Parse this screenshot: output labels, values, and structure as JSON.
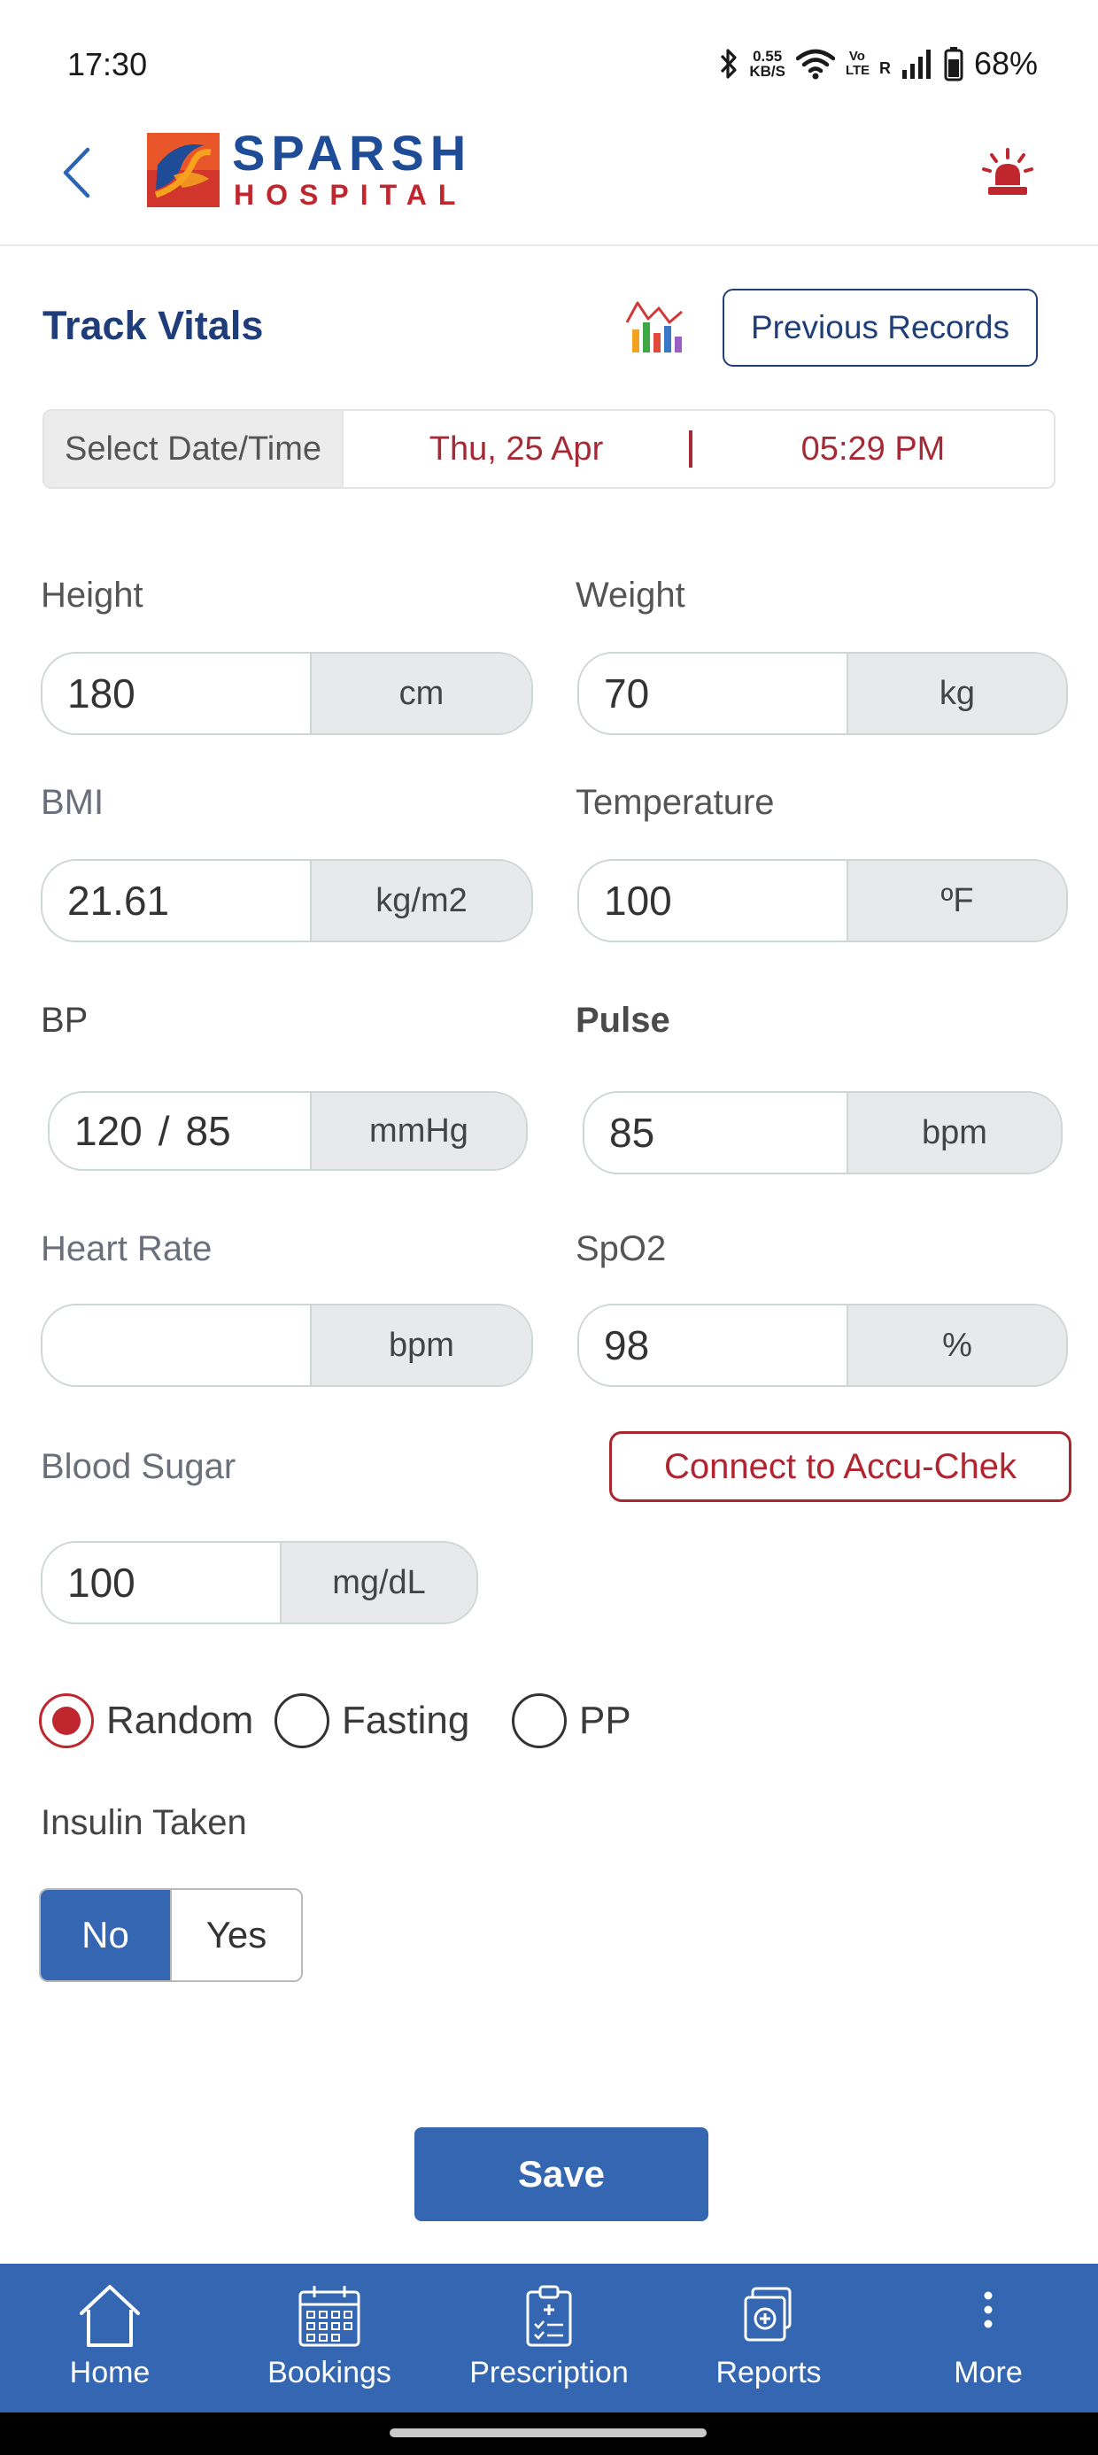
{
  "status_bar": {
    "time": "17:30",
    "net_speed_value": "0.55",
    "net_speed_unit": "KB/S",
    "volte": "Vo LTE",
    "roaming": "R",
    "battery": "68%"
  },
  "header": {
    "logo_line1": "SPARSH",
    "logo_line2": "HOSPITAL"
  },
  "page": {
    "title": "Track Vitals",
    "previous_records_label": "Previous Records"
  },
  "datetime": {
    "label": "Select Date/Time",
    "date": "Thu, 25 Apr",
    "time": "05:29 PM"
  },
  "vitals": {
    "height": {
      "label": "Height",
      "value": "180",
      "unit": "cm"
    },
    "weight": {
      "label": "Weight",
      "value": "70",
      "unit": "kg"
    },
    "bmi": {
      "label": "BMI",
      "value": "21.61",
      "unit": "kg/m2"
    },
    "temperature": {
      "label": "Temperature",
      "value": "100",
      "unit": "ºF"
    },
    "bp": {
      "label": "BP",
      "systolic": "120",
      "separator": "/",
      "diastolic": "85",
      "unit": "mmHg"
    },
    "pulse": {
      "label": "Pulse",
      "value": "85",
      "unit": "bpm"
    },
    "heart_rate": {
      "label": "Heart Rate",
      "value": "",
      "unit": "bpm"
    },
    "spo2": {
      "label": "SpO2",
      "value": "98",
      "unit": "%"
    },
    "blood_sugar": {
      "label": "Blood Sugar",
      "value": "100",
      "unit": "mg/dL"
    }
  },
  "accu_chek_button": "Connect to Accu-Chek",
  "sugar_type": {
    "options": [
      "Random",
      "Fasting",
      "PP"
    ],
    "selected": "Random"
  },
  "insulin": {
    "label": "Insulin Taken",
    "options": [
      "No",
      "Yes"
    ],
    "selected": "No"
  },
  "save_label": "Save",
  "bottom_nav": {
    "items": [
      {
        "label": "Home",
        "icon": "home-icon"
      },
      {
        "label": "Bookings",
        "icon": "calendar-icon"
      },
      {
        "label": "Prescription",
        "icon": "prescription-icon"
      },
      {
        "label": "Reports",
        "icon": "reports-icon"
      },
      {
        "label": "More",
        "icon": "more-vertical-icon"
      }
    ]
  },
  "colors": {
    "primary_blue": "#3466b2",
    "title_navy": "#1f3d7a",
    "accent_red": "#c0262d",
    "unit_gray": "#e7e9ea"
  }
}
